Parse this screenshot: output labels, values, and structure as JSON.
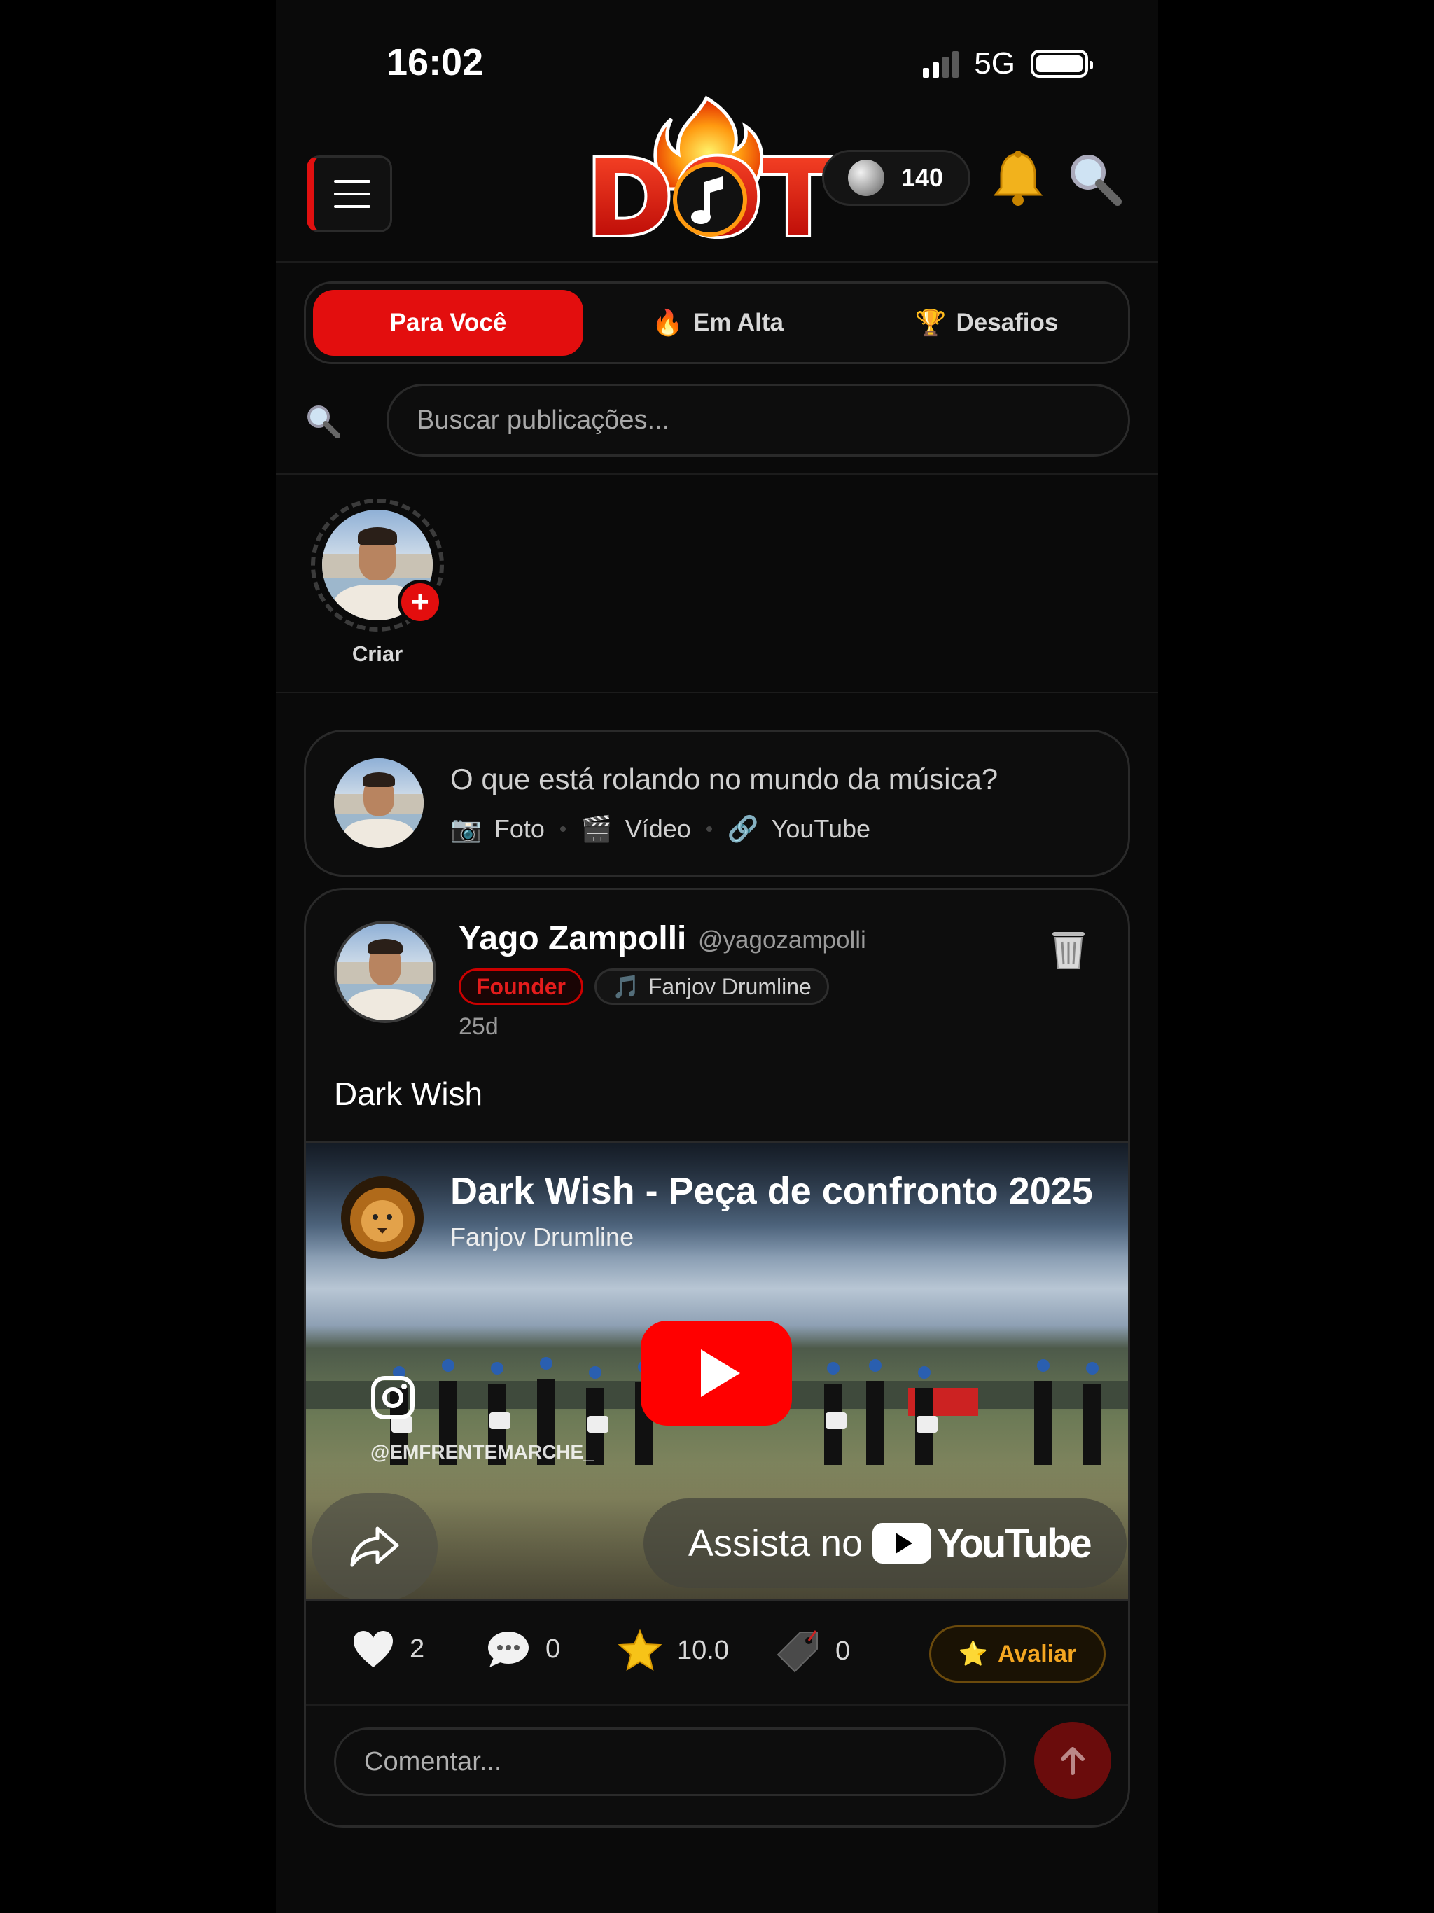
{
  "status_bar": {
    "time": "16:02",
    "network": "5G"
  },
  "header": {
    "logo_text": "DOT",
    "coins": "140"
  },
  "tabs": [
    {
      "label": "Para Você",
      "icon": ""
    },
    {
      "label": "Em Alta",
      "icon": "fire-icon"
    },
    {
      "label": "Desafios",
      "icon": "trophy-icon"
    }
  ],
  "search": {
    "placeholder": "Buscar publicações..."
  },
  "stories": {
    "create_label": "Criar"
  },
  "composer": {
    "prompt": "O que está rolando no mundo da música?",
    "actions": [
      {
        "label": "Foto",
        "icon": "camera-icon"
      },
      {
        "label": "Vídeo",
        "icon": "clapper-icon"
      },
      {
        "label": "YouTube",
        "icon": "link-icon"
      }
    ]
  },
  "post": {
    "author_name": "Yago Zampolli",
    "author_handle": "@yagozampolli",
    "badge": "Founder",
    "group": "Fanjov Drumline",
    "time": "25d",
    "text": "Dark Wish",
    "video": {
      "title": "Dark Wish - Peça de confronto 2025",
      "channel": "Fanjov Drumline",
      "watermark": "@EMFRENTEMARCHE_",
      "watch_label": "Assista no",
      "youtube_word": "YouTube"
    },
    "stats": {
      "likes": "2",
      "comments": "0",
      "rating": "10.0",
      "tags": "0"
    },
    "rate_label": "Avaliar",
    "comment_placeholder": "Comentar..."
  },
  "colors": {
    "accent": "#e30e0e",
    "gold": "#f4a621",
    "background": "#0a0a0a"
  }
}
